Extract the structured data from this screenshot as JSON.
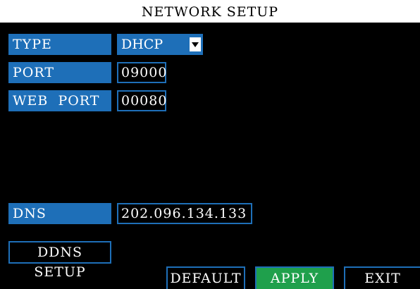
{
  "window": {
    "title": "NETWORK SETUP"
  },
  "fields": {
    "type": {
      "label": "TYPE",
      "value": "DHCP"
    },
    "port": {
      "label": "PORT",
      "value": "09000"
    },
    "web_port": {
      "label": "WEB  PORT",
      "value": "00080"
    },
    "dns": {
      "label": "DNS",
      "value": "202.096.134.133"
    }
  },
  "buttons": {
    "ddns_setup": "DDNS SETUP",
    "default": "DEFAULT",
    "apply": "APPLY",
    "exit": "EXIT"
  },
  "colors": {
    "background": "#000000",
    "label_blue": "#1e6fb8",
    "apply_green": "#1fa04c",
    "text": "#ffffff"
  },
  "icons": {
    "type_dropdown": "chevron-down-icon"
  }
}
